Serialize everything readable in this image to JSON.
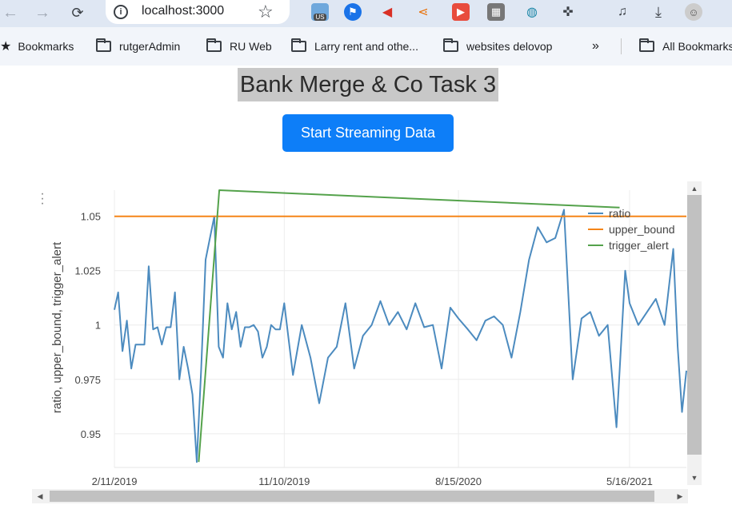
{
  "browser": {
    "url": "localhost:3000",
    "extension_badge": "US",
    "bookmarks": [
      "Bookmarks",
      "rutgerAdmin",
      "RU Web",
      "Larry rent and othe...",
      "websites delovop",
      "All Bookmarks"
    ]
  },
  "app": {
    "title": "Bank Merge & Co Task 3",
    "button_label": "Start Streaming Data"
  },
  "chart_data": {
    "type": "line",
    "ylabel": "ratio, upper_bound, trigger_alert",
    "xlabel": "",
    "x_ticks": [
      "2/11/2019",
      "11/10/2019",
      "8/15/2020",
      "5/16/2021"
    ],
    "y_ticks": [
      0.95,
      0.975,
      1,
      1.025,
      1.05
    ],
    "ylim": [
      0.9345,
      1.062
    ],
    "xlim": [
      "2019-02-11",
      "2021-08-15"
    ],
    "legend_position": "top-right",
    "grid": true,
    "series": [
      {
        "name": "ratio",
        "color": "#4c8bbf",
        "x": [
          "2019-02-11",
          "2019-02-17",
          "2019-02-24",
          "2019-03-03",
          "2019-03-10",
          "2019-03-17",
          "2019-03-24",
          "2019-03-31",
          "2019-04-07",
          "2019-04-14",
          "2019-04-21",
          "2019-04-28",
          "2019-05-05",
          "2019-05-12",
          "2019-05-19",
          "2019-05-26",
          "2019-06-02",
          "2019-06-09",
          "2019-06-16",
          "2019-06-23",
          "2019-06-30",
          "2019-07-07",
          "2019-07-14",
          "2019-07-21",
          "2019-07-28",
          "2019-08-04",
          "2019-08-11",
          "2019-08-18",
          "2019-08-25",
          "2019-09-01",
          "2019-09-08",
          "2019-09-15",
          "2019-09-22",
          "2019-09-29",
          "2019-10-06",
          "2019-10-13",
          "2019-10-20",
          "2019-10-27",
          "2019-11-03",
          "2019-11-10",
          "2019-11-24",
          "2019-12-08",
          "2019-12-22",
          "2020-01-05",
          "2020-01-19",
          "2020-02-02",
          "2020-02-16",
          "2020-03-01",
          "2020-03-15",
          "2020-03-29",
          "2020-04-12",
          "2020-04-26",
          "2020-05-10",
          "2020-05-24",
          "2020-06-07",
          "2020-06-21",
          "2020-07-05",
          "2020-07-19",
          "2020-08-02",
          "2020-08-15",
          "2020-08-30",
          "2020-09-13",
          "2020-09-27",
          "2020-10-11",
          "2020-10-25",
          "2020-11-08",
          "2020-11-22",
          "2020-12-06",
          "2020-12-20",
          "2021-01-03",
          "2021-01-17",
          "2021-01-31",
          "2021-02-14",
          "2021-02-28",
          "2021-03-14",
          "2021-03-28",
          "2021-04-11",
          "2021-04-25",
          "2021-05-09",
          "2021-05-16",
          "2021-05-30",
          "2021-06-13",
          "2021-06-27",
          "2021-07-11",
          "2021-07-25",
          "2021-08-01",
          "2021-08-08",
          "2021-08-15"
        ],
        "values": [
          1.007,
          1.015,
          0.988,
          1.002,
          0.98,
          0.991,
          0.991,
          0.991,
          1.027,
          0.998,
          0.999,
          0.991,
          0.999,
          0.999,
          1.015,
          0.975,
          0.99,
          0.98,
          0.968,
          0.937,
          0.98,
          1.03,
          1.04,
          1.05,
          0.99,
          0.985,
          1.01,
          0.998,
          1.006,
          0.99,
          0.999,
          0.999,
          1.0,
          0.997,
          0.985,
          0.99,
          1.0,
          0.998,
          0.998,
          1.01,
          0.977,
          1.0,
          0.985,
          0.964,
          0.985,
          0.99,
          1.01,
          0.98,
          0.995,
          1.0,
          1.011,
          1.0,
          1.006,
          0.998,
          1.01,
          0.999,
          1.0,
          0.98,
          1.008,
          1.003,
          0.998,
          0.993,
          1.002,
          1.004,
          1.0,
          0.985,
          1.006,
          1.03,
          1.045,
          1.038,
          1.04,
          1.053,
          0.975,
          1.003,
          1.006,
          0.995,
          1.0,
          0.953,
          1.025,
          1.01,
          1.0,
          1.006,
          1.012,
          1.0,
          1.035,
          0.99,
          0.96,
          0.979
        ]
      },
      {
        "name": "upper_bound",
        "color": "#f58518",
        "x": [
          "2019-02-11",
          "2021-08-15"
        ],
        "values": [
          1.05,
          1.05
        ]
      },
      {
        "name": "trigger_alert",
        "color": "#54a24b",
        "x": [
          "2019-06-26",
          "2019-07-29",
          "2021-04-30"
        ],
        "values": [
          0.937,
          1.062,
          1.054
        ]
      }
    ]
  }
}
